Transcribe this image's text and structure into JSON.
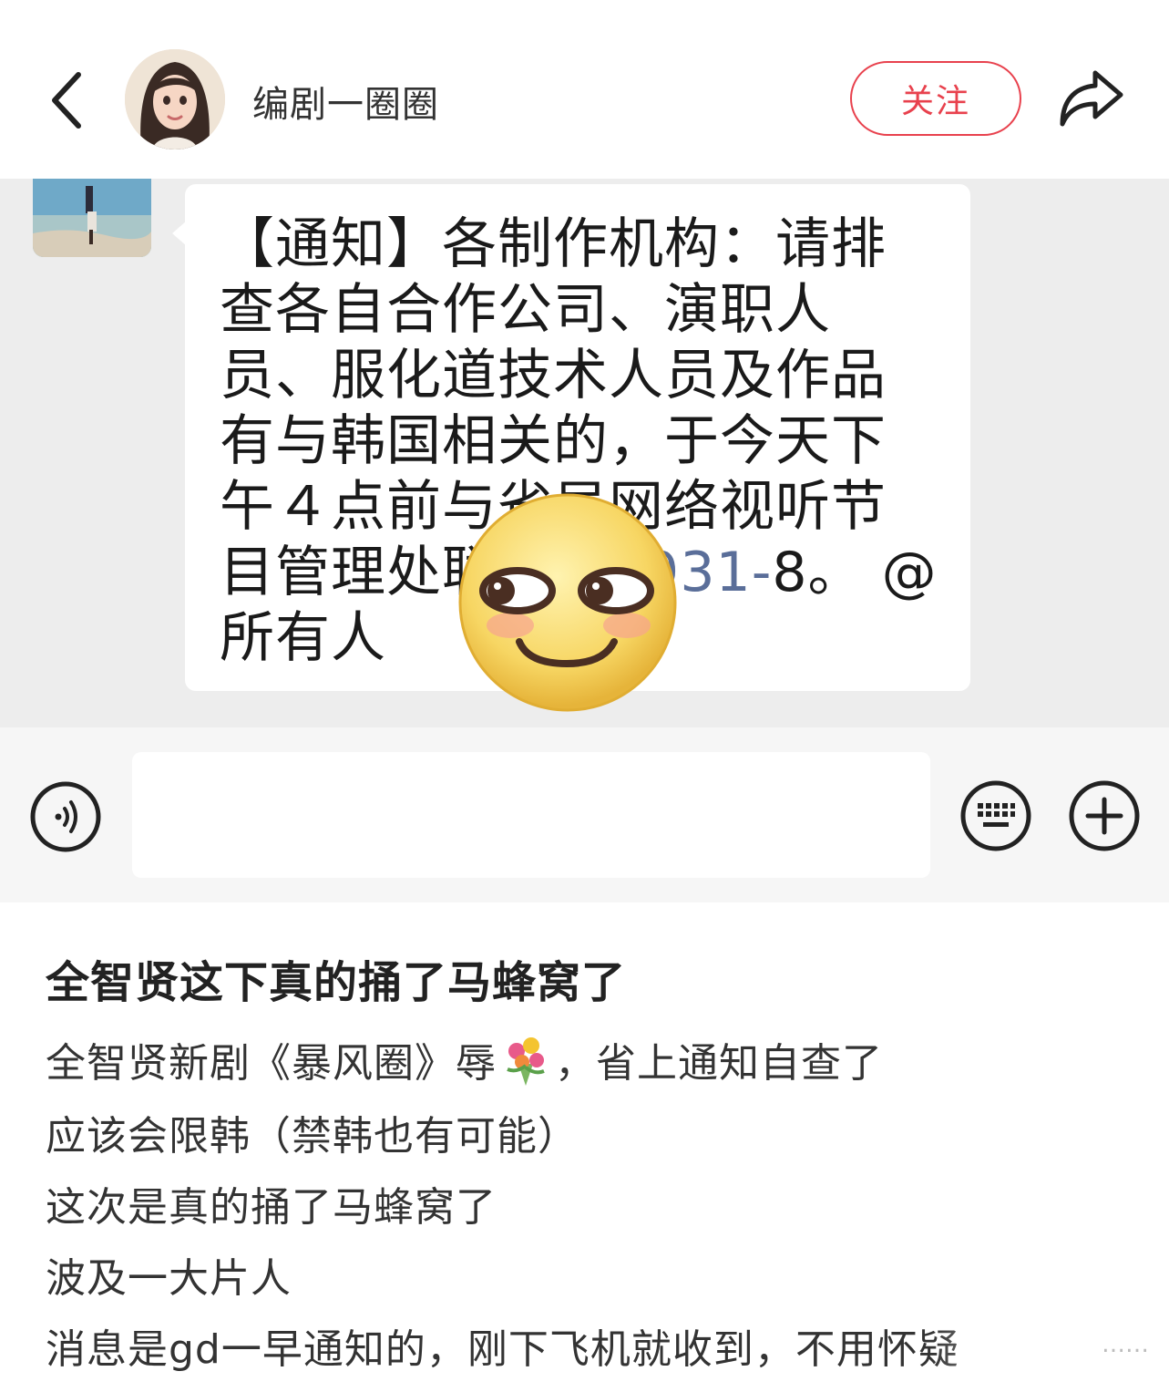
{
  "header": {
    "username": "编剧一圈圈",
    "follow_label": "关注"
  },
  "chat": {
    "message_parts": {
      "before_phone": "【通知】各制作机构：请排查各自合作公司、演职人员、服化道技术人员及作品有与韩国相关的，于今天下午４点前与省局网络视听节目管理处联系，",
      "phone": "0931-",
      "after_phone": "8。 @所有人"
    },
    "input_value": ""
  },
  "post": {
    "title": "全智贤这下真的捅了马蜂窝了",
    "lines": [
      {
        "before_emoji": "全智贤新剧《暴风圈》辱",
        "after_emoji": "，省上通知自查了"
      },
      {
        "text": "应该会限韩（禁韩也有可能）"
      },
      {
        "text": "这次是真的捅了马蜂窝了"
      },
      {
        "text": "波及一大片人"
      },
      {
        "text": "消息是gd一早通知的，刚下飞机就收到，不用怀疑"
      }
    ],
    "more_indicator": "……"
  },
  "icons": {
    "back": "chevron-left-icon",
    "share": "share-arrow-icon",
    "voice": "voice-icon",
    "keyboard": "keyboard-icon",
    "plus": "plus-icon",
    "emoji": "smirk-emoji-icon",
    "bouquet": "bouquet-emoji-icon"
  },
  "colors": {
    "accent": "#e8414d",
    "chat_background": "#ededed",
    "phone_link": "#5a6e99"
  }
}
